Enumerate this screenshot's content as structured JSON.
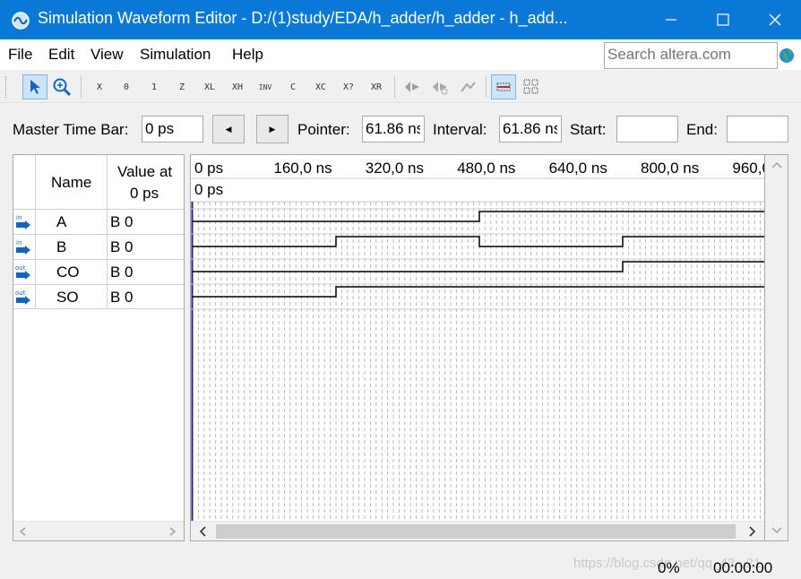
{
  "window": {
    "title": "Simulation Waveform Editor - D:/(1)study/EDA/h_adder/h_adder - h_add...",
    "titlebar_color": "#0a78d7"
  },
  "menu": [
    "File",
    "Edit",
    "View",
    "Simulation",
    "Help"
  ],
  "search": {
    "placeholder": "Search altera.com",
    "icon": "globe-icon"
  },
  "toolbar": {
    "icons": [
      "pointer-icon",
      "zoom-icon",
      "forcing-unknown-icon",
      "forcing-low-icon",
      "forcing-high-icon",
      "high-impedance-icon",
      "weak-low-icon",
      "weak-high-icon",
      "invert-icon",
      "count-value-icon",
      "clock-icon",
      "arbitrary-value-icon",
      "random-value-icon",
      "snap-to-grid-icon",
      "grid-icon",
      "grid-settings-icon",
      "run-functional-icon",
      "run-timing-icon",
      "netlist-icon"
    ],
    "texts": [
      "X",
      "0",
      "1",
      "Z",
      "XL",
      "XH",
      "INV",
      "C",
      "XC",
      "X?",
      "XR"
    ]
  },
  "timebar": {
    "master_label": "Master Time Bar:",
    "master_value": "0 ps",
    "prev": "◀",
    "next": "▶",
    "pointer_label": "Pointer:",
    "pointer_value": "61.86 ns",
    "interval_label": "Interval:",
    "interval_value": "61.86 ns",
    "start_label": "Start:",
    "start_value": "",
    "end_label": "End:",
    "end_value": ""
  },
  "grid": {
    "name_header": "Name",
    "value_header_line1": "Value at",
    "value_header_line2": "0 ps",
    "time_labels": [
      "0 ps",
      "160,0 ns",
      "320,0 ns",
      "480,0 ns",
      "640,0 ns",
      "800,0 ns",
      "960,0 ns"
    ],
    "cursor_label": "0 ps",
    "axis_ns": {
      "min": 0,
      "max": 1000
    }
  },
  "signals": [
    {
      "dir": "in",
      "name": "A",
      "value": "B 0",
      "transitions_ns": [
        0,
        500
      ],
      "levels": [
        0,
        1
      ]
    },
    {
      "dir": "in",
      "name": "B",
      "value": "B 0",
      "transitions_ns": [
        0,
        250,
        500,
        750
      ],
      "levels": [
        0,
        1,
        0,
        1
      ]
    },
    {
      "dir": "out",
      "name": "CO",
      "value": "B 0",
      "transitions_ns": [
        0,
        750
      ],
      "levels": [
        0,
        1
      ]
    },
    {
      "dir": "out",
      "name": "SO",
      "value": "B 0",
      "transitions_ns": [
        0,
        250
      ],
      "levels": [
        0,
        1
      ]
    }
  ],
  "status": {
    "progress": "0%",
    "elapsed": "00:00:00",
    "watermark": "https://blog.csdn.net/qq_43...21"
  }
}
